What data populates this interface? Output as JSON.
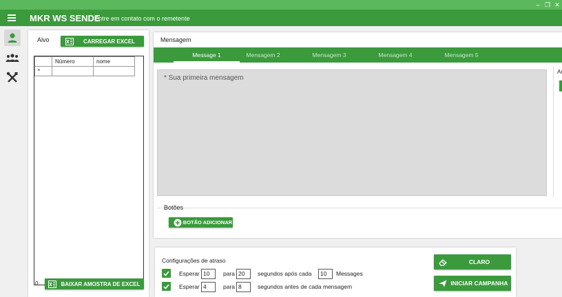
{
  "window": {
    "minimize": "–",
    "maximize": "❐",
    "close": "✕"
  },
  "header": {
    "title": "MKR WS SENDE",
    "subtitle": "Entre em contato com o remetente"
  },
  "nav": {
    "items": [
      {
        "icon": "user-icon"
      },
      {
        "icon": "group-icon"
      },
      {
        "icon": "tools-icon"
      }
    ]
  },
  "target": {
    "label": "Alvo",
    "load_button": "CARREGAR EXCEL",
    "grid": {
      "columns": [
        "Número",
        "nome"
      ],
      "new_row_marker": "*"
    },
    "count": "0",
    "download_button": "BAIXAR AMOSTRA DE EXCEL"
  },
  "message": {
    "label": "Mensagem",
    "tabs": [
      "Message 1",
      "Mensagem 2",
      "Mensagem 3",
      "Mensagem 4",
      "Mensagem 5"
    ],
    "placeholder": "* Sua primeira mensagem",
    "side_label": "Ar",
    "buttons_label": "Botões",
    "add_button": "BOTÃO ADICIONAR"
  },
  "delay": {
    "title": "Configurações de atraso",
    "row1": {
      "wait": "Esperar",
      "from": "10",
      "to_label": "para",
      "to": "20",
      "after": "segundos após cada",
      "count": "10",
      "unit": "Messages"
    },
    "row2": {
      "wait": "Esperar",
      "from": "4",
      "to_label": "para",
      "to": "8",
      "after": "segundos antes de cada mensagem"
    }
  },
  "actions": {
    "clear": "CLARO",
    "start": "INICIAR CAMPANHA"
  },
  "colors": {
    "primary": "#3a9a3c",
    "titlebar": "#5cb85c"
  }
}
